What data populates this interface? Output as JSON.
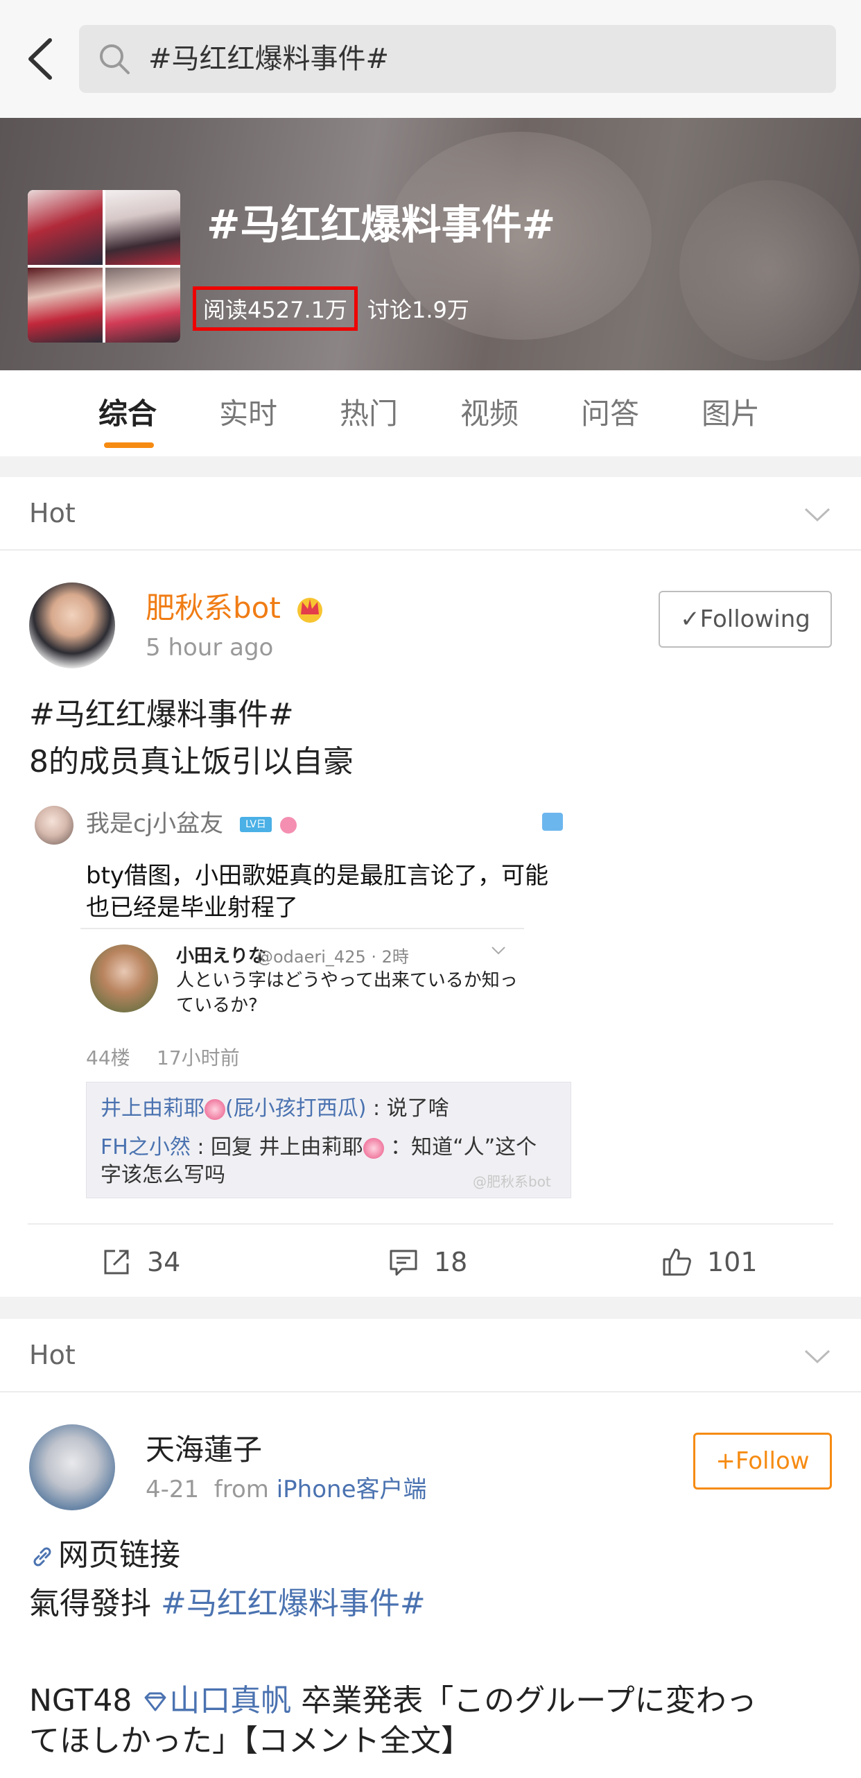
{
  "search": {
    "query": "#马红红爆料事件#"
  },
  "banner": {
    "title": "#马红红爆料事件#",
    "read_label": "阅读4527.1万",
    "discuss_label": "讨论1.9万"
  },
  "tabs": [
    {
      "label": "综合"
    },
    {
      "label": "实时"
    },
    {
      "label": "热门"
    },
    {
      "label": "视频"
    },
    {
      "label": "问答"
    },
    {
      "label": "图片"
    }
  ],
  "post1": {
    "section": "Hot",
    "author": "肥秋系bot",
    "time": "5 hour ago",
    "button": "✓Following",
    "topic": "#马红红爆料事件#",
    "text": "8的成员真让饭引以自豪",
    "embed": {
      "user": "我是cj小盆友",
      "level": "LV日",
      "text": "bty借图，小田歌姫真的是最肛言论了，可能也已经是毕业射程了",
      "tweet_name": "小田えりな",
      "tweet_handle": "@odaeri_425 · 2時",
      "tweet_text": "人という字はどうやって出来ているか知っているか?",
      "floor": "44楼",
      "floor_time": "17小时前",
      "reply1_user": "井上由莉耶",
      "reply1_user_suffix": "(屁小孩打西瓜)",
      "reply1_text": " : 说了啥",
      "reply2_user": "FH之小然",
      "reply2_text": " : 回复 井上由莉耶",
      "reply2_text_end": " ：知道“人”这个字该怎么写吗",
      "watermark": "@肥秋系bot"
    },
    "actions": {
      "share": "34",
      "comment": "18",
      "like": "101"
    }
  },
  "post2": {
    "section": "Hot",
    "author": "天海蓮子",
    "date": "4-21",
    "from_label": "from",
    "source": "iPhone客户端",
    "button": "+Follow",
    "link_text": "网页链接",
    "text_prefix": "氣得發抖 ",
    "topic": "#马红红爆料事件#",
    "text2_prefix": "NGT48 ",
    "mention": "山口真帆",
    "text2_line1_rest": " 卒業発表「このグループに変わっ",
    "text2_line2": "てほしかった」【コメント全文】"
  },
  "colors": {
    "accent": "#f68b12",
    "link": "#4a72b0",
    "highlight_box": "#ee0000"
  },
  "icons": [
    "back-icon",
    "search-icon",
    "chevron-down-icon",
    "crown-icon",
    "share-icon",
    "comment-icon",
    "like-icon",
    "link-icon",
    "diamond-icon"
  ]
}
